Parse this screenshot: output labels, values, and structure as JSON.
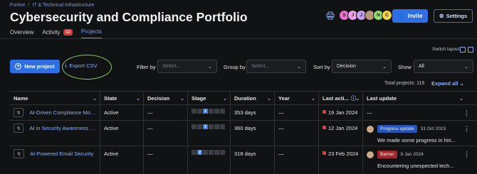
{
  "breadcrumb": [
    "Fortive",
    "IT & Technical Infrastructure"
  ],
  "page_title": "Cybersecurity and Compliance Portfolio",
  "tabs": [
    {
      "label": "Overview"
    },
    {
      "label": "Activity",
      "count": "42"
    },
    {
      "label": "Projects",
      "active": true
    }
  ],
  "header": {
    "avatars": [
      {
        "initial": "S",
        "color": "#f06bd0"
      },
      {
        "initial": "J",
        "color": "#f0a0e8"
      },
      {
        "initial": "J",
        "color": "#c89ff5"
      },
      {
        "initial": "",
        "color": "#b99878"
      },
      {
        "initial": "N",
        "color": "#8fe070"
      },
      {
        "initial": "C",
        "color": "#f2d34a"
      }
    ],
    "invite_label": "Invite",
    "settings_label": "Settings"
  },
  "toolbar": {
    "switch_layout": "Switch layout",
    "new_project": "New project",
    "export_csv": "Export CSV",
    "filter_by": {
      "label": "Filter by",
      "placeholder": "Select..."
    },
    "group_by": {
      "label": "Group by",
      "placeholder": "Select..."
    },
    "sort_by": {
      "label": "Sort by",
      "value": "Decision"
    },
    "show": {
      "label": "Show",
      "value": "All"
    },
    "total_projects": "Total projects: 119",
    "expand_all": "Expand all"
  },
  "table": {
    "columns": [
      "Name",
      "State",
      "Decision",
      "Stage",
      "Duration",
      "Year",
      "Last acti...",
      "Last update"
    ],
    "rows": [
      {
        "name": "AI-Driven Compliance Moni...",
        "state": "Active",
        "decision": "—",
        "stage": "3",
        "duration": "353 days",
        "year": "—",
        "last_activity": "19 Jan 2024",
        "last_update": "—"
      },
      {
        "name": "AI in Security Awareness Tr...",
        "state": "Active",
        "decision": "—",
        "stage": "3",
        "duration": "360 days",
        "year": "—",
        "last_activity": "12 Jan 2024",
        "update_tag": "Progress update",
        "update_date": "31 Oct 2023",
        "update_text": "We made some progress in hiri..."
      },
      {
        "name": "AI-Powered Email Security",
        "state": "Active",
        "decision": "—",
        "stage": "2",
        "duration": "318 days",
        "year": "—",
        "last_activity": "23 Feb 2024",
        "update_tag": "Barrier",
        "update_date": "9 Jan 2024",
        "update_text": "Encountering unexpected tech..."
      }
    ]
  }
}
